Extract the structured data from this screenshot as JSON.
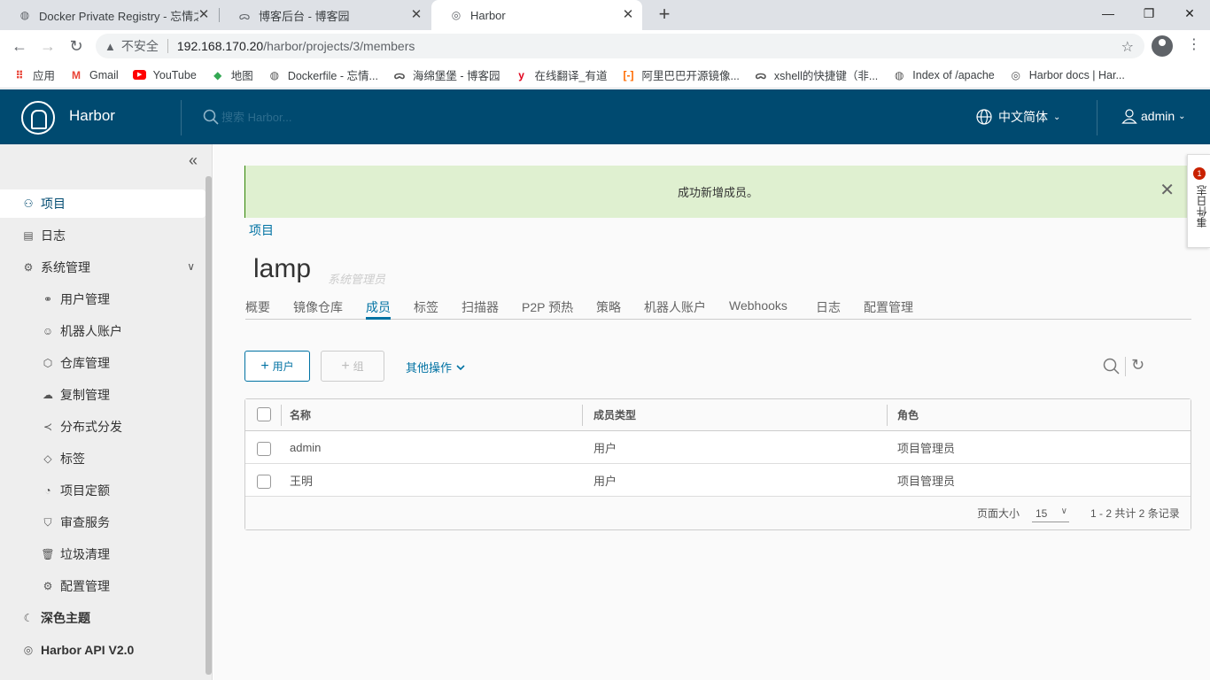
{
  "browser": {
    "tabs": [
      {
        "title": "Docker Private Registry - 忘情之",
        "active": false
      },
      {
        "title": "博客后台 - 博客园",
        "active": false
      },
      {
        "title": "Harbor",
        "active": true
      }
    ],
    "address": {
      "security_label": "不安全",
      "host": "192.168.170.20",
      "path": "/harbor/projects/3/members"
    },
    "bookmarks": [
      {
        "label": "应用",
        "icon": "apps-grid-icon"
      },
      {
        "label": "Gmail",
        "icon": "gmail-icon"
      },
      {
        "label": "YouTube",
        "icon": "youtube-icon"
      },
      {
        "label": "地图",
        "icon": "maps-icon"
      },
      {
        "label": "Dockerfile - 忘情...",
        "icon": "globe-icon"
      },
      {
        "label": "海绵堡堡 - 博客园",
        "icon": "cnblogs-icon"
      },
      {
        "label": "在线翻译_有道",
        "icon": "youdao-icon"
      },
      {
        "label": "阿里巴巴开源镜像...",
        "icon": "aliyun-icon"
      },
      {
        "label": "xshell的快捷键（非...",
        "icon": "cnblogs-icon"
      },
      {
        "label": "Index of /apache",
        "icon": "globe-icon"
      },
      {
        "label": "Harbor docs | Har...",
        "icon": "harbor-icon"
      }
    ]
  },
  "header": {
    "brand": "Harbor",
    "search_placeholder": "搜索 Harbor...",
    "language": "中文简体",
    "user": "admin"
  },
  "sidebar": {
    "items": [
      {
        "label": "项目",
        "icon": "project-icon",
        "active": true
      },
      {
        "label": "日志",
        "icon": "log-icon"
      },
      {
        "label": "系统管理",
        "icon": "admin-icon"
      },
      {
        "label": "用户管理",
        "icon": "users-icon"
      },
      {
        "label": "机器人账户",
        "icon": "robot-icon"
      },
      {
        "label": "仓库管理",
        "icon": "registry-icon"
      },
      {
        "label": "复制管理",
        "icon": "replication-icon"
      },
      {
        "label": "分布式分发",
        "icon": "share-icon"
      },
      {
        "label": "标签",
        "icon": "tag-icon"
      },
      {
        "label": "项目定额",
        "icon": "quota-icon"
      },
      {
        "label": "审查服务",
        "icon": "shield-icon"
      },
      {
        "label": "垃圾清理",
        "icon": "trash-icon"
      },
      {
        "label": "配置管理",
        "icon": "gear-icon"
      },
      {
        "label": "深色主题",
        "icon": "moon-icon"
      },
      {
        "label": "Harbor API V2.0",
        "icon": "api-icon"
      }
    ]
  },
  "alert": {
    "message": "成功新增成员。"
  },
  "event_log": {
    "label": "事件日志",
    "count": "1"
  },
  "breadcrumb": "项目",
  "project": {
    "name": "lamp",
    "role": "系统管理员"
  },
  "tabs": [
    "概要",
    "镜像仓库",
    "成员",
    "标签",
    "扫描器",
    "P2P 预热",
    "策略",
    "机器人账户",
    "Webhooks",
    "日志",
    "配置管理"
  ],
  "active_tab": "成员",
  "actions": {
    "add_user": "用户",
    "add_group": "组",
    "more": "其他操作"
  },
  "table": {
    "columns": [
      "名称",
      "成员类型",
      "角色"
    ],
    "rows": [
      {
        "name": "admin",
        "type": "用户",
        "role": "项目管理员"
      },
      {
        "name": "王明",
        "type": "用户",
        "role": "项目管理员"
      }
    ],
    "footer": {
      "page_size_label": "页面大小",
      "page_size": "15",
      "summary": "1 - 2 共计 2 条记录"
    }
  }
}
